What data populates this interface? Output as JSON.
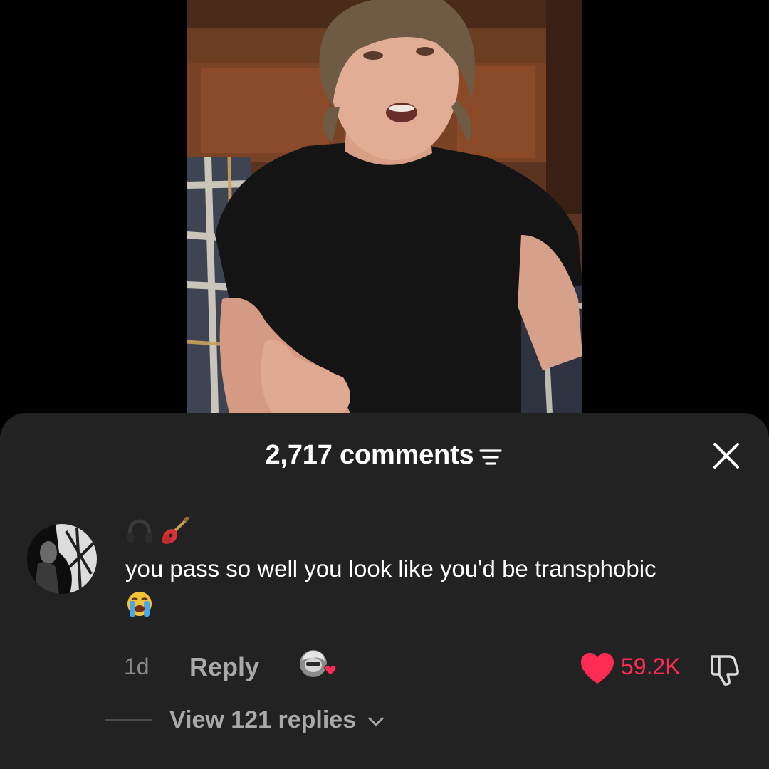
{
  "comments_sheet": {
    "title": "2,717 comments",
    "filter_icon": "filter-lines-icon",
    "close_icon": "close-x-icon"
  },
  "comment": {
    "username_icons": [
      "headphones-icon",
      "guitar-icon"
    ],
    "text": "you pass so well you look like you'd be transphobic",
    "emoji": "loudly-crying-face",
    "time": "1d",
    "reply_label": "Reply",
    "like_count": "59.2K",
    "like_color": "#fe2c55",
    "liked": true,
    "creator_liked": true,
    "view_replies_label": "View 121 replies"
  },
  "colors": {
    "sheet_bg": "#222222",
    "muted_text": "#a9a9a9",
    "accent": "#fe2c55"
  }
}
